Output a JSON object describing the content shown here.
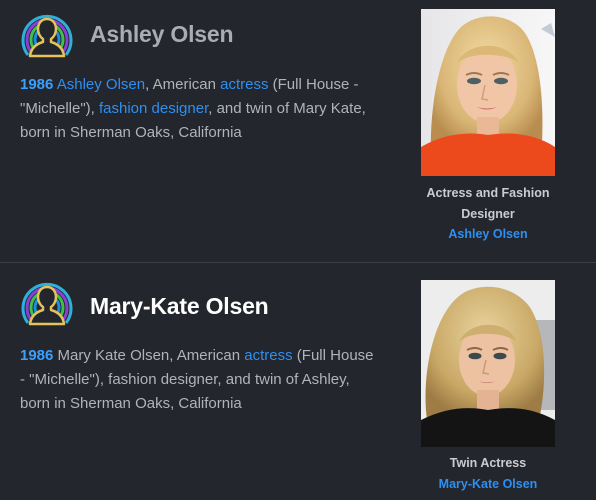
{
  "people": [
    {
      "name": "Ashley Olsen",
      "desc": {
        "year": "1986",
        "name_link": "Ashley Olsen",
        "t1": ", American ",
        "link1": "actress",
        "t2": " (Full House - \"Michelle\"), ",
        "link2": "fashion designer",
        "t3": ", and twin of Mary Kate, born in Sherman Oaks, California"
      },
      "caption": "Actress and Fashion Designer",
      "caption_link": "Ashley Olsen"
    },
    {
      "name": "Mary-Kate Olsen",
      "desc": {
        "year": "1986",
        "t1": " Mary Kate Olsen, American ",
        "link1": "actress",
        "t2": " (Full House - \"Michelle\"), fashion designer, and twin of Ashley, born in Sherman Oaks, California"
      },
      "caption": "Twin Actress",
      "caption_link": "Mary-Kate Olsen"
    }
  ],
  "colors": {
    "background": "#23262d",
    "link": "#2f8ff0",
    "year": "#3aa0ff",
    "icon_outline": "#e3c35a"
  }
}
